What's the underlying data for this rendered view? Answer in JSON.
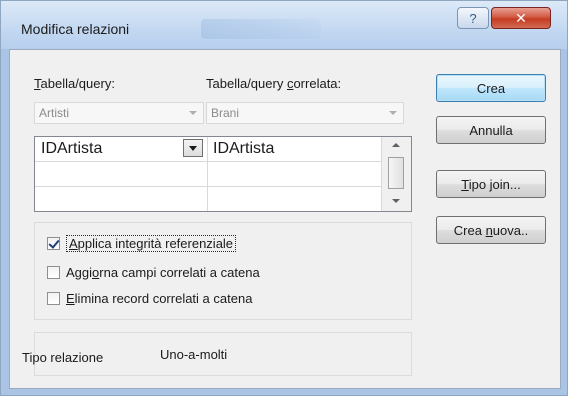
{
  "window": {
    "title": "Modifica relazioni",
    "help_glyph": "?",
    "close_glyph": "✕"
  },
  "tables": {
    "left_label_prefix": "",
    "left_label_u": "T",
    "left_label_rest": "abella/query:",
    "right_label_prefix": "Tabella/query ",
    "right_label_u": "c",
    "right_label_rest": "orrelata:",
    "left_value": "Artisti",
    "right_value": "Brani"
  },
  "grid": {
    "rows": [
      {
        "left": "IDArtista",
        "right": "IDArtista"
      },
      {
        "left": "",
        "right": ""
      },
      {
        "left": "",
        "right": ""
      }
    ]
  },
  "options": {
    "integrity": {
      "pre": "",
      "u": "A",
      "post": "pplica integrità referenziale",
      "checked": true
    },
    "cascade_update": {
      "pre": "Aggi",
      "u": "o",
      "post": "rna campi correlati a catena",
      "checked": false
    },
    "cascade_delete": {
      "pre": "",
      "u": "E",
      "post": "limina record correlati a catena",
      "checked": false
    }
  },
  "relation": {
    "label": "Tipo relazione",
    "value": "Uno-a-molti"
  },
  "buttons": {
    "create": "Crea",
    "cancel": "Annulla",
    "join_u": "T",
    "join_rest": "ipo join...",
    "new_pre": "Crea ",
    "new_u": "n",
    "new_rest": "uova.."
  }
}
